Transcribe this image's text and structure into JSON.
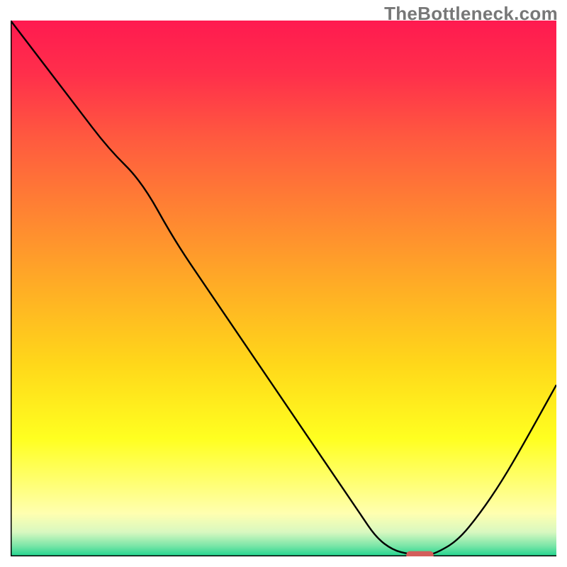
{
  "watermark": "TheBottleneck.com",
  "colors": {
    "gradient_stops": [
      {
        "offset": 0.0,
        "color": "#ff1a50"
      },
      {
        "offset": 0.1,
        "color": "#ff2f4b"
      },
      {
        "offset": 0.22,
        "color": "#ff5a3f"
      },
      {
        "offset": 0.36,
        "color": "#ff8432"
      },
      {
        "offset": 0.5,
        "color": "#ffae25"
      },
      {
        "offset": 0.64,
        "color": "#ffd71a"
      },
      {
        "offset": 0.78,
        "color": "#ffff20"
      },
      {
        "offset": 0.86,
        "color": "#ffff70"
      },
      {
        "offset": 0.92,
        "color": "#ffffb0"
      },
      {
        "offset": 0.955,
        "color": "#d8f8c0"
      },
      {
        "offset": 0.98,
        "color": "#7ce6a8"
      },
      {
        "offset": 1.0,
        "color": "#1fd48e"
      }
    ],
    "line": "#000000",
    "axis": "#000000",
    "marker": "#d35d5b"
  },
  "chart_data": {
    "type": "line",
    "title": "",
    "xlabel": "",
    "ylabel": "",
    "xlim": [
      0,
      100
    ],
    "ylim": [
      0,
      100
    ],
    "series": [
      {
        "name": "curve",
        "x": [
          0,
          6,
          12,
          18,
          24,
          30,
          36,
          42,
          48,
          54,
          60,
          64,
          67,
          70,
          73,
          76,
          78,
          82,
          86,
          90,
          94,
          100
        ],
        "y": [
          100,
          92,
          84,
          76,
          70,
          59,
          50,
          41,
          32,
          23,
          14,
          8,
          3.5,
          1.2,
          0.4,
          0.2,
          0.6,
          3.0,
          8.0,
          14,
          21,
          32
        ]
      }
    ],
    "marker": {
      "x_min": 72.5,
      "x_max": 77.5,
      "y": 0.25
    },
    "annotations": []
  }
}
